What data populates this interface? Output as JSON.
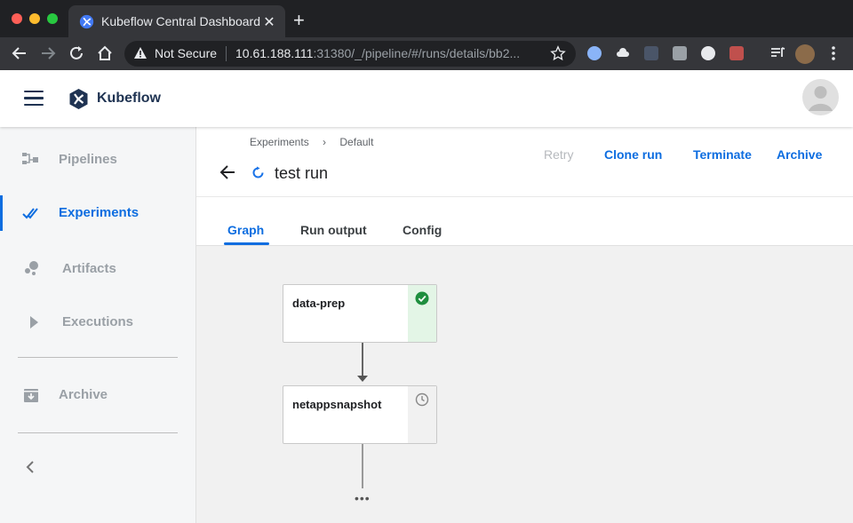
{
  "browser": {
    "tab_title": "Kubeflow Central Dashboard",
    "security_label": "Not Secure",
    "url_host": "10.61.188.111",
    "url_rest": ":31380/_/pipeline/#/runs/details/bb2..."
  },
  "app": {
    "brand": "Kubeflow",
    "brand_color": "#1f3352",
    "accent_color": "#0d6de0"
  },
  "sidebar": {
    "items": [
      {
        "label": "Pipelines",
        "icon": "pipelines-icon",
        "active": false
      },
      {
        "label": "Experiments",
        "icon": "experiments-icon",
        "active": true
      },
      {
        "label": "Artifacts",
        "icon": "artifacts-icon",
        "active": false
      },
      {
        "label": "Executions",
        "icon": "executions-icon",
        "active": false
      },
      {
        "label": "Archive",
        "icon": "archive-icon",
        "active": false
      }
    ]
  },
  "run": {
    "breadcrumb": [
      "Experiments",
      "Default"
    ],
    "breadcrumb_sep": "›",
    "title": "test run",
    "actions": {
      "retry": "Retry",
      "clone": "Clone run",
      "terminate": "Terminate",
      "archive": "Archive"
    },
    "tabs": [
      "Graph",
      "Run output",
      "Config"
    ],
    "active_tab": "Graph"
  },
  "graph": {
    "nodes": [
      {
        "label": "data-prep",
        "status": "succeeded",
        "status_color": "#1e8e3e"
      },
      {
        "label": "netappsnapshot",
        "status": "pending",
        "status_color": "#888888"
      }
    ],
    "more_label": "•••"
  }
}
